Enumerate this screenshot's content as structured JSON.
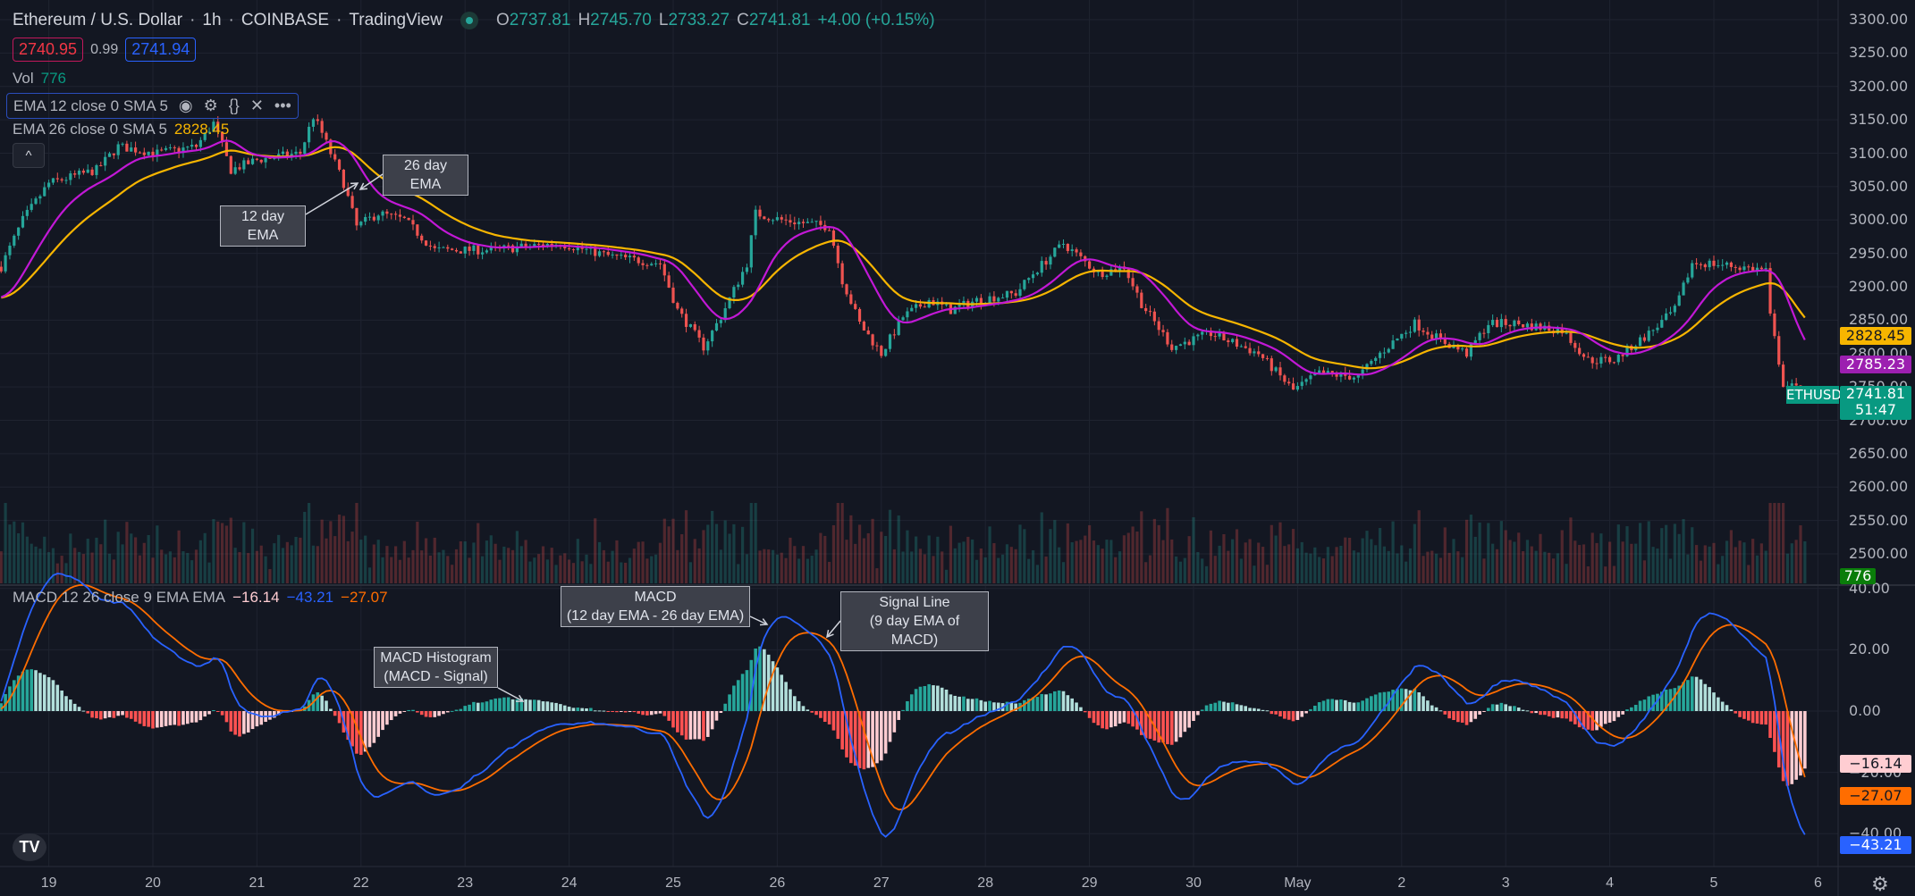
{
  "header": {
    "symbol": "Ethereum / U.S. Dollar",
    "interval": "1h",
    "exchange": "COINBASE",
    "source": "TradingView",
    "open_label": "O",
    "open": "2737.81",
    "high_label": "H",
    "high": "2745.70",
    "low_label": "L",
    "low": "2733.27",
    "close_label": "C",
    "close": "2741.81",
    "change": "+4.00 (+0.15%)",
    "bid": "2740.95",
    "spread": "0.99",
    "ask": "2741.94",
    "market_status": "market-open-dot"
  },
  "legends": {
    "vol_label": "Vol",
    "vol_value": "776",
    "ema12": "EMA 12 close 0 SMA 5",
    "ema26": "EMA 26 close 0 SMA 5",
    "ema26_value": "2828.45",
    "macd": "MACD 12 26 close 9 EMA EMA",
    "macd_hist": "−16.14",
    "macd_line": "−43.21",
    "macd_signal": "−27.07",
    "icons": [
      "eye-icon",
      "gear-icon",
      "braces-icon",
      "close-icon",
      "more-icon"
    ],
    "collapse_glyph": "^"
  },
  "annotations": {
    "ema26": "26 day EMA",
    "ema12": "12 day EMA",
    "macd_title": "MACD",
    "macd_sub": "(12 day EMA - 26 day EMA)",
    "signal_title": "Signal Line",
    "signal_sub": "(9 day EMA of MACD)",
    "hist_title": "MACD Histogram",
    "hist_sub": "(MACD - Signal)"
  },
  "price_tags": {
    "ema26": "2828.45",
    "ema12": "2785.23",
    "symbol": "ETHUSD",
    "last": "2741.81",
    "countdown": "51:47",
    "volume": "776",
    "hist": "−16.14",
    "signal": "−27.07",
    "macd": "−43.21"
  },
  "colors": {
    "background": "#131722",
    "up": "#26a69a",
    "down": "#ef5350",
    "ema12": "#c218d6",
    "ema26": "#f7b500",
    "macd": "#2962ff",
    "signal": "#ff6d00",
    "hist_up_grow": "#26a69a",
    "hist_up_fall": "#b2dfdb",
    "hist_dn_grow": "#ff5252",
    "hist_dn_fall": "#ffcdd2"
  },
  "chart_data": {
    "type": "candlestick",
    "price_axis": {
      "ticks": [
        "3300.00",
        "3250.00",
        "3200.00",
        "3150.00",
        "3100.00",
        "3050.00",
        "3000.00",
        "2950.00",
        "2900.00",
        "2850.00",
        "2800.00",
        "2750.00",
        "2700.00",
        "2650.00",
        "2600.00",
        "2550.00",
        "2500.00"
      ],
      "range": [
        2480,
        3310
      ]
    },
    "macd_axis": {
      "ticks": [
        "40.00",
        "20.00",
        "0.00",
        "−20.00",
        "−40.00"
      ],
      "range": [
        -45,
        42
      ]
    },
    "time_axis": [
      {
        "label": "19",
        "t": "04-19 00:00"
      },
      {
        "label": "20",
        "t": "04-20 00:00"
      },
      {
        "label": "21",
        "t": "04-21 00:00"
      },
      {
        "label": "22",
        "t": "04-22 00:00"
      },
      {
        "label": "23",
        "t": "04-23 00:00"
      },
      {
        "label": "24",
        "t": "04-24 00:00"
      },
      {
        "label": "25",
        "t": "04-25 00:00"
      },
      {
        "label": "26",
        "t": "04-26 00:00"
      },
      {
        "label": "27",
        "t": "04-27 00:00"
      },
      {
        "label": "28",
        "t": "04-28 00:00"
      },
      {
        "label": "29",
        "t": "04-29 00:00"
      },
      {
        "label": "30",
        "t": "04-30 00:00"
      },
      {
        "label": "May",
        "t": "05-01 00:00"
      },
      {
        "label": "2",
        "t": "05-02 00:00"
      },
      {
        "label": "3",
        "t": "05-03 00:00"
      },
      {
        "label": "4",
        "t": "05-04 00:00"
      },
      {
        "label": "5",
        "t": "05-05 00:00"
      },
      {
        "label": "6",
        "t": "05-06 00:00"
      }
    ],
    "close_path": [
      [
        "04-18 13:00",
        2930
      ],
      [
        "04-18 18:00",
        3000
      ],
      [
        "04-19 00:00",
        3055
      ],
      [
        "04-19 11:00",
        3075
      ],
      [
        "04-19 16:00",
        3110
      ],
      [
        "04-20 01:00",
        3100
      ],
      [
        "04-20 10:00",
        3110
      ],
      [
        "04-20 14:00",
        3145
      ],
      [
        "04-20 18:00",
        3075
      ],
      [
        "04-21 00:00",
        3090
      ],
      [
        "04-21 10:00",
        3100
      ],
      [
        "04-21 13:00",
        3155
      ],
      [
        "04-21 15:00",
        3130
      ],
      [
        "04-21 20:00",
        3055
      ],
      [
        "04-21 23:00",
        2990
      ],
      [
        "04-22 04:00",
        3010
      ],
      [
        "04-22 10:00",
        3000
      ],
      [
        "04-22 17:00",
        2955
      ],
      [
        "04-23 06:00",
        2955
      ],
      [
        "04-23 22:00",
        2965
      ],
      [
        "04-24 10:00",
        2945
      ],
      [
        "04-24 21:00",
        2935
      ],
      [
        "04-25 01:00",
        2865
      ],
      [
        "04-25 07:00",
        2810
      ],
      [
        "04-25 11:00",
        2855
      ],
      [
        "04-25 17:00",
        2935
      ],
      [
        "04-25 19:00",
        3010
      ],
      [
        "04-26 01:00",
        3000
      ],
      [
        "04-26 12:00",
        2990
      ],
      [
        "04-26 15:00",
        2910
      ],
      [
        "04-26 19:00",
        2845
      ],
      [
        "04-27 00:00",
        2800
      ],
      [
        "04-27 05:00",
        2855
      ],
      [
        "04-27 11:00",
        2880
      ],
      [
        "04-27 16:00",
        2865
      ],
      [
        "04-27 22:00",
        2880
      ],
      [
        "04-28 07:00",
        2890
      ],
      [
        "04-28 11:00",
        2920
      ],
      [
        "04-28 18:00",
        2965
      ],
      [
        "04-29 02:00",
        2920
      ],
      [
        "04-29 08:00",
        2930
      ],
      [
        "04-29 12:00",
        2875
      ],
      [
        "04-29 19:00",
        2810
      ],
      [
        "04-30 04:00",
        2830
      ],
      [
        "04-30 15:00",
        2800
      ],
      [
        "04-30 23:00",
        2745
      ],
      [
        "05-01 05:00",
        2770
      ],
      [
        "05-01 14:00",
        2765
      ],
      [
        "05-01 19:00",
        2800
      ],
      [
        "05-02 03:00",
        2845
      ],
      [
        "05-02 09:00",
        2820
      ],
      [
        "05-02 15:00",
        2800
      ],
      [
        "05-02 20:00",
        2845
      ],
      [
        "05-03 02:00",
        2845
      ],
      [
        "05-03 13:00",
        2835
      ],
      [
        "05-03 19:00",
        2790
      ],
      [
        "05-04 01:00",
        2790
      ],
      [
        "05-04 09:00",
        2830
      ],
      [
        "05-04 15:00",
        2865
      ],
      [
        "05-04 19:00",
        2935
      ],
      [
        "05-04 23:00",
        2935
      ],
      [
        "05-05 12:00",
        2925
      ],
      [
        "05-05 13:00",
        2855
      ],
      [
        "05-05 16:00",
        2755
      ],
      [
        "05-05 21:00",
        2741.81
      ]
    ],
    "indicators": [
      "EMA 12 (SMA 5)",
      "EMA 26 (SMA 5)",
      "Volume",
      "MACD 12 26 9"
    ]
  }
}
